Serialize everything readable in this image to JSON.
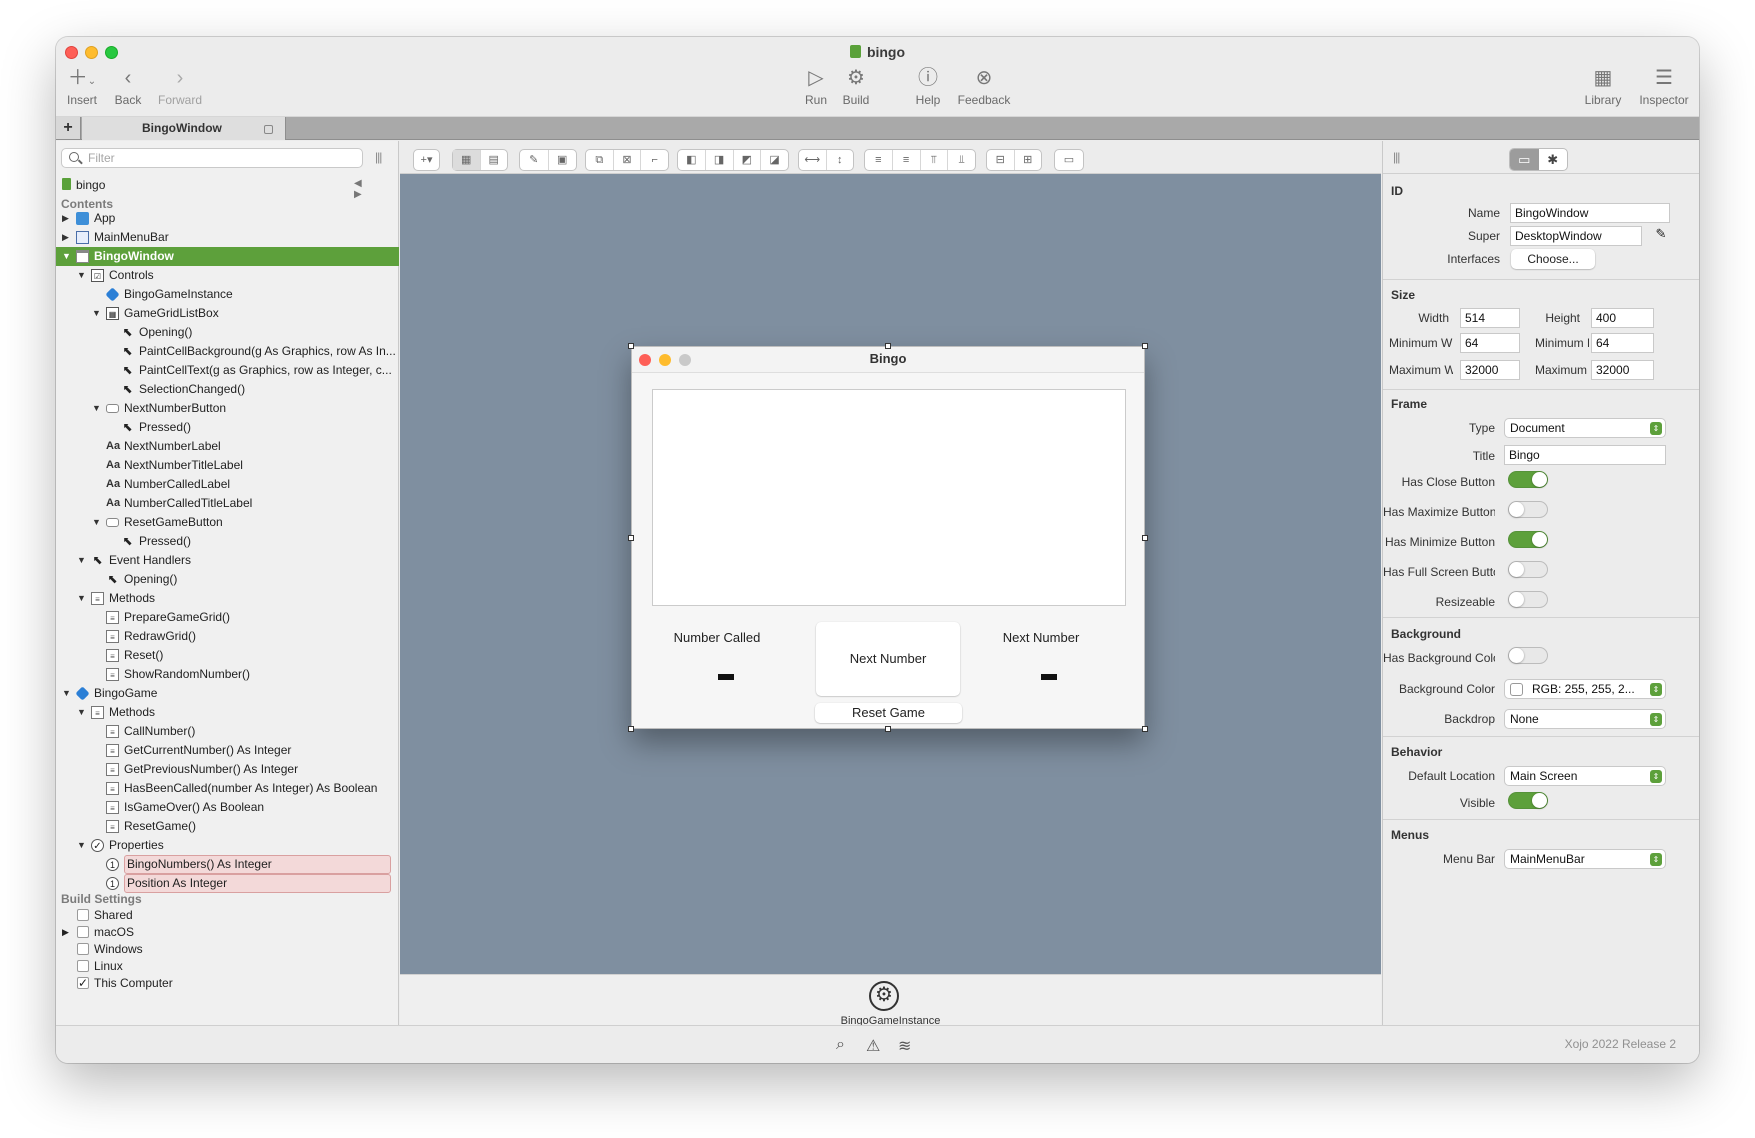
{
  "window": {
    "title": "bingo"
  },
  "toolbar": {
    "insert": "Insert",
    "back": "Back",
    "forward": "Forward",
    "run": "Run",
    "build": "Build",
    "help": "Help",
    "feedback": "Feedback",
    "library": "Library",
    "inspector": "Inspector"
  },
  "tabs": {
    "plus": "+",
    "active": "BingoWindow"
  },
  "navigator": {
    "filter_placeholder": "Filter",
    "project": "bingo",
    "contents_heading": "Contents",
    "tree": [
      {
        "label": "App",
        "level": 0,
        "twisty": "▶",
        "icon": "app-icon"
      },
      {
        "label": "MainMenuBar",
        "level": 0,
        "twisty": "▶",
        "icon": "menubar-icon"
      },
      {
        "label": "BingoWindow",
        "level": 0,
        "twisty": "▼",
        "icon": "window-icon",
        "selected": true
      },
      {
        "label": "Controls",
        "level": 1,
        "twisty": "▼",
        "icon": "controls-icon"
      },
      {
        "label": "BingoGameInstance",
        "level": 2,
        "twisty": "",
        "icon": "class-instance-icon"
      },
      {
        "label": "GameGridListBox",
        "level": 2,
        "twisty": "▼",
        "icon": "listbox-icon"
      },
      {
        "label": "Opening()",
        "level": 3,
        "twisty": "",
        "icon": "event-icon"
      },
      {
        "label": "PaintCellBackground(g As Graphics, row As In...",
        "level": 3,
        "twisty": "",
        "icon": "event-icon"
      },
      {
        "label": "PaintCellText(g as Graphics, row as Integer, c...",
        "level": 3,
        "twisty": "",
        "icon": "event-icon"
      },
      {
        "label": "SelectionChanged()",
        "level": 3,
        "twisty": "",
        "icon": "event-icon"
      },
      {
        "label": "NextNumberButton",
        "level": 2,
        "twisty": "▼",
        "icon": "button-icon"
      },
      {
        "label": "Pressed()",
        "level": 3,
        "twisty": "",
        "icon": "event-icon"
      },
      {
        "label": "NextNumberLabel",
        "level": 2,
        "twisty": "",
        "icon": "label-icon"
      },
      {
        "label": "NextNumberTitleLabel",
        "level": 2,
        "twisty": "",
        "icon": "label-icon"
      },
      {
        "label": "NumberCalledLabel",
        "level": 2,
        "twisty": "",
        "icon": "label-icon"
      },
      {
        "label": "NumberCalledTitleLabel",
        "level": 2,
        "twisty": "",
        "icon": "label-icon"
      },
      {
        "label": "ResetGameButton",
        "level": 2,
        "twisty": "▼",
        "icon": "button-icon"
      },
      {
        "label": "Pressed()",
        "level": 3,
        "twisty": "",
        "icon": "event-icon"
      },
      {
        "label": "Event Handlers",
        "level": 1,
        "twisty": "▼",
        "icon": "event-icon"
      },
      {
        "label": "Opening()",
        "level": 2,
        "twisty": "",
        "icon": "event-icon"
      },
      {
        "label": "Methods",
        "level": 1,
        "twisty": "▼",
        "icon": "method-icon"
      },
      {
        "label": "PrepareGameGrid()",
        "level": 2,
        "twisty": "",
        "icon": "method-icon"
      },
      {
        "label": "RedrawGrid()",
        "level": 2,
        "twisty": "",
        "icon": "method-icon"
      },
      {
        "label": "Reset()",
        "level": 2,
        "twisty": "",
        "icon": "method-icon"
      },
      {
        "label": "ShowRandomNumber()",
        "level": 2,
        "twisty": "",
        "icon": "method-icon"
      },
      {
        "label": "BingoGame",
        "level": 0,
        "twisty": "▼",
        "icon": "class-instance-icon"
      },
      {
        "label": "Methods",
        "level": 1,
        "twisty": "▼",
        "icon": "method-icon"
      },
      {
        "label": "CallNumber()",
        "level": 2,
        "twisty": "",
        "icon": "method-icon"
      },
      {
        "label": "GetCurrentNumber() As Integer",
        "level": 2,
        "twisty": "",
        "icon": "method-icon"
      },
      {
        "label": "GetPreviousNumber() As Integer",
        "level": 2,
        "twisty": "",
        "icon": "method-icon"
      },
      {
        "label": "HasBeenCalled(number As Integer) As Boolean",
        "level": 2,
        "twisty": "",
        "icon": "method-icon"
      },
      {
        "label": "IsGameOver() As Boolean",
        "level": 2,
        "twisty": "",
        "icon": "method-icon"
      },
      {
        "label": "ResetGame()",
        "level": 2,
        "twisty": "",
        "icon": "method-icon"
      },
      {
        "label": "Properties",
        "level": 1,
        "twisty": "▼",
        "icon": "check-icon"
      },
      {
        "label": "BingoNumbers() As Integer",
        "level": 2,
        "twisty": "",
        "icon": "property-icon",
        "highlight": true
      },
      {
        "label": "Position As Integer",
        "level": 2,
        "twisty": "",
        "icon": "property-icon",
        "highlight": true
      }
    ],
    "build_heading": "Build Settings",
    "build": [
      {
        "label": "Shared",
        "checked": false,
        "twisty": ""
      },
      {
        "label": "macOS",
        "checked": false,
        "twisty": "▶"
      },
      {
        "label": "Windows",
        "checked": false,
        "twisty": ""
      },
      {
        "label": "Linux",
        "checked": false,
        "twisty": ""
      },
      {
        "label": "This Computer",
        "checked": true,
        "twisty": ""
      }
    ]
  },
  "designer": {
    "window_title": "Bingo",
    "number_called_title": "Number Called",
    "next_number_title": "Next Number",
    "next_button": "Next Number",
    "reset_button": "Reset Game",
    "tray_item": "BingoGameInstance"
  },
  "inspector": {
    "id_heading": "ID",
    "name_label": "Name",
    "name_value": "BingoWindow",
    "super_label": "Super",
    "super_value": "DesktopWindow",
    "interfaces_label": "Interfaces",
    "interfaces_button": "Choose...",
    "size_heading": "Size",
    "width_label": "Width",
    "width_value": "514",
    "height_label": "Height",
    "height_value": "400",
    "min_w_label": "Minimum Wic",
    "min_w_value": "64",
    "min_h_label": "Minimum Hei",
    "min_h_value": "64",
    "max_w_label": "Maximum Wi",
    "max_w_value": "32000",
    "max_h_label": "Maximum He",
    "max_h_value": "32000",
    "frame_heading": "Frame",
    "type_label": "Type",
    "type_value": "Document",
    "title_label": "Title",
    "title_value": "Bingo",
    "close_label": "Has Close Button",
    "maximize_label": "Has Maximize Button",
    "minimize_label": "Has Minimize Button",
    "fullscreen_label": "Has Full Screen Button",
    "resizeable_label": "Resizeable",
    "background_heading": "Background",
    "has_bg_label": "Has Background Color",
    "bg_color_label": "Background Color",
    "bg_color_value": "RGB: 255, 255, 2...",
    "backdrop_label": "Backdrop",
    "backdrop_value": "None",
    "behavior_heading": "Behavior",
    "location_label": "Default Location",
    "location_value": "Main Screen",
    "visible_label": "Visible",
    "menus_heading": "Menus",
    "menubar_label": "Menu Bar",
    "menubar_value": "MainMenuBar",
    "toggles": {
      "close": true,
      "maximize": false,
      "minimize": true,
      "fullscreen": false,
      "resizeable": false,
      "has_bg": false,
      "visible": true
    }
  },
  "status": {
    "version": "Xojo 2022 Release 2"
  },
  "colors": {
    "accent_green": "#5da03b",
    "canvas_bg": "#7f8fa0",
    "highlight_row": "#f3d9d9"
  }
}
